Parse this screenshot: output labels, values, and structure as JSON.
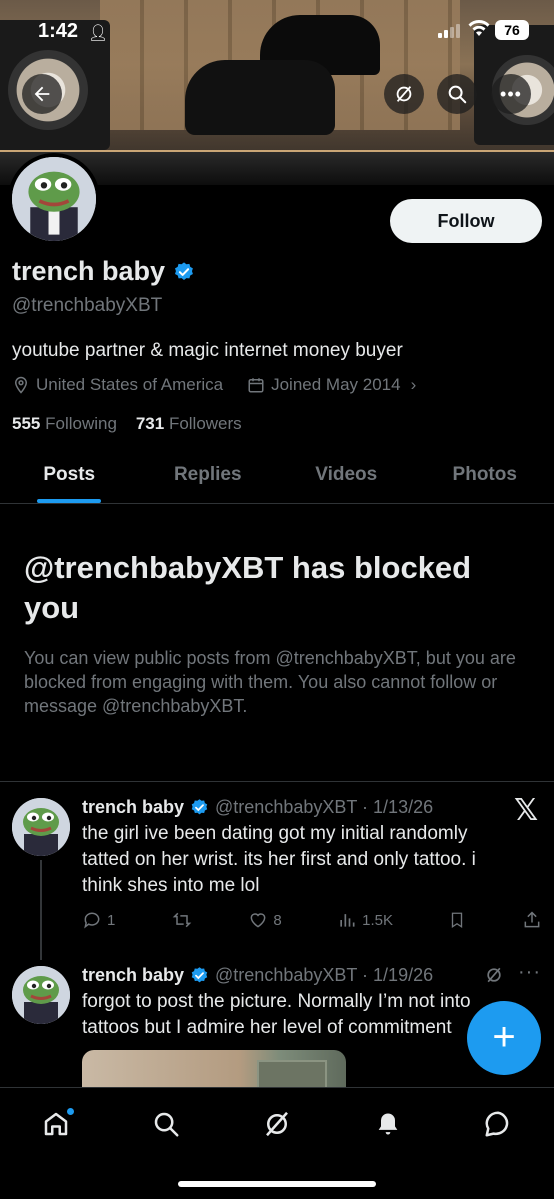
{
  "status_bar": {
    "time": "1:42",
    "battery": "76"
  },
  "profile": {
    "display_name": "trench baby",
    "handle": "@trenchbabyXBT",
    "bio": "youtube partner & magic internet money buyer",
    "location": "United States of America",
    "joined": "Joined May 2014",
    "following_count": "555",
    "following_label": "Following",
    "followers_count": "731",
    "followers_label": "Followers",
    "follow_label": "Follow"
  },
  "tabs": [
    {
      "label": "Posts",
      "active": true
    },
    {
      "label": "Replies",
      "active": false
    },
    {
      "label": "Videos",
      "active": false
    },
    {
      "label": "Photos",
      "active": false
    }
  ],
  "blocked": {
    "title": "@trenchbabyXBT has blocked you",
    "text": "You can view public posts from @trenchbabyXBT, but you are blocked from engaging with them. You also cannot follow or message @trenchbabyXBT."
  },
  "posts": [
    {
      "name": "trench baby",
      "handle_date": "@trenchbabyXBT · 1/13/26",
      "text": "the girl ive been dating got my initial randomly tatted on her wrist. its her first and only tattoo. i think shes into me lol",
      "replies": "1",
      "likes": "8",
      "views": "1.5K"
    },
    {
      "name": "trench baby",
      "handle_date": "@trenchbabyXBT · 1/19/26",
      "text": "forgot to post the picture. Normally I’m not into tattoos but I admire her level of commitment"
    }
  ],
  "colors": {
    "accent": "#1d9bf0",
    "secondary_text": "#71767b",
    "background": "#000000"
  }
}
